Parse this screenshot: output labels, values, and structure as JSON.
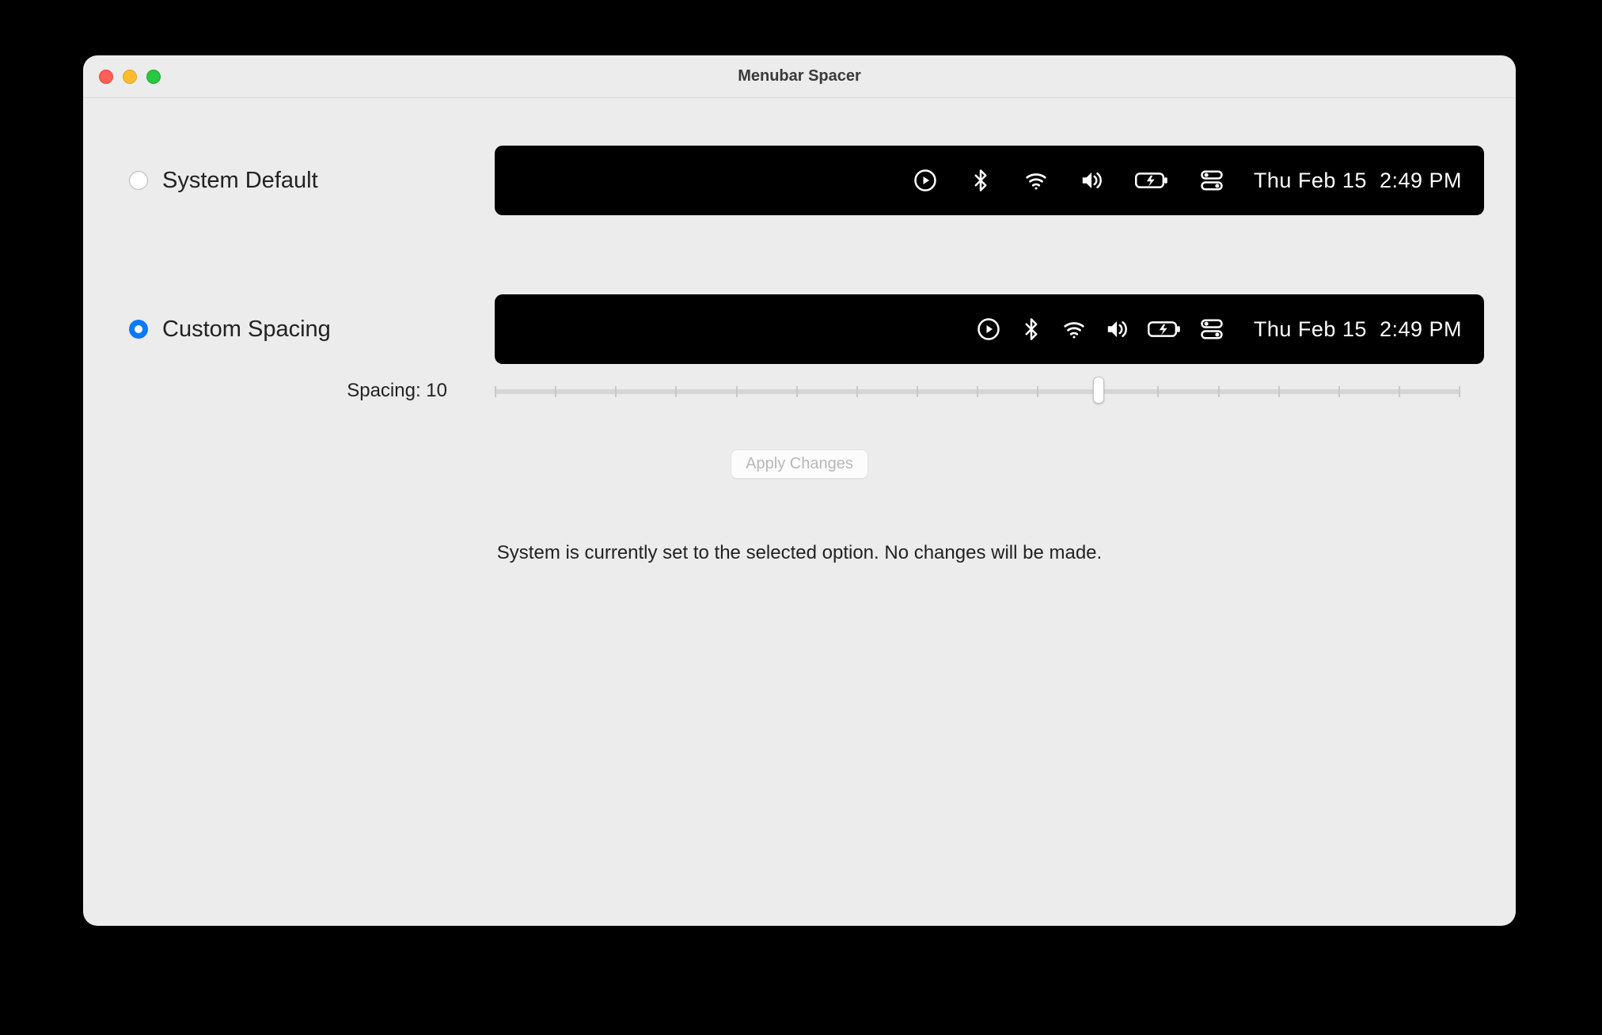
{
  "window": {
    "title": "Menubar Spacer"
  },
  "options": {
    "system_default": {
      "label": "System Default",
      "selected": false
    },
    "custom_spacing": {
      "label": "Custom Spacing",
      "selected": true
    }
  },
  "preview": {
    "date": "Thu Feb 15",
    "time": "2:49 PM"
  },
  "spacing": {
    "label_prefix": "Spacing: ",
    "value": 10,
    "min": 0,
    "max": 16,
    "ticks": 17
  },
  "apply_button": {
    "label": "Apply Changes",
    "enabled": false
  },
  "status": {
    "message": "System is currently set to the selected option. No changes will be made."
  }
}
